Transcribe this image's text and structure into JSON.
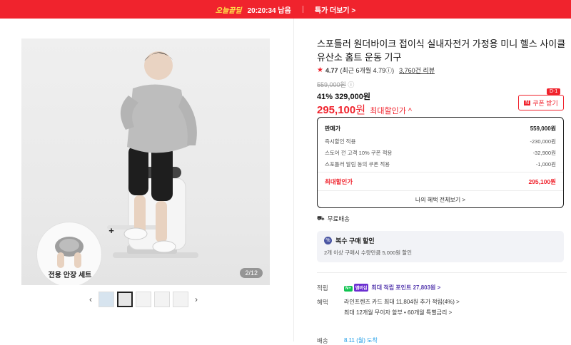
{
  "topbar": {
    "deal_label": "오늘끝딜",
    "timer": "20:20:34 남음",
    "more_link": "특가 더보기 >"
  },
  "gallery": {
    "counter": "2/12",
    "inset_label": "전용 안장 세트",
    "inset_plus": "+",
    "prev_arrow": "‹",
    "next_arrow": "›",
    "thumbnail_count": 5,
    "active_thumbnail": 2
  },
  "product": {
    "title": "스포틀러 원더바이크 접이식 실내자전거 가정용 미니 헬스 사이클 유산소 홈트 운동 기구",
    "rating": "4.77",
    "rating_recent": "(최근 6개월 4.79ⓘ)",
    "reviews": "3,760건 리뷰",
    "original_price": "559,000원",
    "discount_text": "41% 329,000원",
    "final_price": "295,100",
    "final_unit": "원",
    "final_label": "최대할인가 ^",
    "coupon_label": "쿠폰 받기",
    "coupon_tag": "D-1",
    "coupon_icon": "N"
  },
  "price_box": {
    "rows": [
      {
        "label": "판매가",
        "value": "559,000원"
      },
      {
        "label": "즉시할인 적용",
        "value": "-230,000원"
      },
      {
        "label": "스토어 전 고객 10% 쿠폰 적용",
        "value": "-32,900원"
      },
      {
        "label": "스포틀러 알림 동의 쿠폰 적용",
        "value": "-1,000원"
      }
    ],
    "total_label": "최대할인가",
    "total_value": "295,100원",
    "benefit_link": "나의 혜택 전체보기 >"
  },
  "shipping": "무료배송",
  "multi_buy": {
    "title": "복수 구매 할인",
    "desc": "2개 이상 구매시 수량만큼 5,000원 할인",
    "icon": "%"
  },
  "info": {
    "points_label": "적립",
    "points_value": "최대 적립 포인트 27,803원 >",
    "npay": "N+",
    "npay2": "멤버십",
    "benefit_label": "혜택",
    "benefit_line1": "라인프렌즈 카드 최대 11,804원 추가 적립(4%) >",
    "benefit_line2": "최대 12개월 무이자 할부 • 60개월 특별금리 >",
    "delivery_label": "배송",
    "delivery_value": "8.11 (월) 도착"
  }
}
